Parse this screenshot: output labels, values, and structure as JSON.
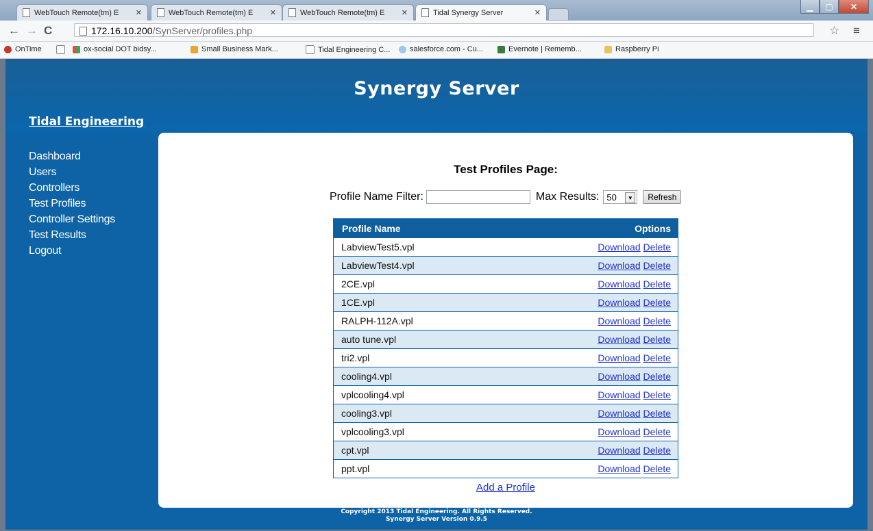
{
  "browser": {
    "tabs": [
      {
        "title": "WebTouch Remote(tm) E",
        "active": false
      },
      {
        "title": "WebTouch Remote(tm) E",
        "active": false
      },
      {
        "title": "WebTouch Remote(tm) E",
        "active": false
      },
      {
        "title": "Tidal Synergy Server",
        "active": true
      }
    ],
    "url_host": "172.16.10.200",
    "url_path": "/SynServer/profiles.php",
    "bookmarks": [
      {
        "label": "OnTime",
        "icon": "ontime-icon",
        "color": "#c0392b"
      },
      {
        "label": "",
        "icon": "page-icon",
        "color": "#ffffff"
      },
      {
        "label": "ox-social DOT bidsy...",
        "icon": "windows-icon",
        "color": "#3a7bd5"
      },
      {
        "label": "Small Business Mark...",
        "icon": "marketing-icon",
        "color": "#e8a534"
      },
      {
        "label": "Tidal Engineering C...",
        "icon": "page-icon",
        "color": "#ffffff"
      },
      {
        "label": "salesforce.com - Cu...",
        "icon": "cloud-icon",
        "color": "#9ec9ea"
      },
      {
        "label": "Evernote | Rememb...",
        "icon": "evernote-icon",
        "color": "#3b7a3b"
      },
      {
        "label": "Raspberry Pi",
        "icon": "folder-icon",
        "color": "#e8c55a"
      }
    ]
  },
  "site": {
    "title": "Synergy Server",
    "brand": "Tidal Engineering",
    "nav": [
      "Dashboard",
      "Users",
      "Controllers",
      "Test Profiles",
      "Controller Settings",
      "Test Results",
      "Logout"
    ],
    "footer_line1": "Copyright 2013 Tidal Engineering. All Rights Reserved.",
    "footer_line2": "Synergy Server Version 0.9.5"
  },
  "page": {
    "heading": "Test Profiles Page:",
    "filter_label": "Profile Name Filter:",
    "filter_value": "",
    "max_label": "Max Results:",
    "max_value": "50",
    "refresh_label": "Refresh",
    "table_headers": {
      "name": "Profile Name",
      "options": "Options"
    },
    "download_label": "Download",
    "delete_label": "Delete",
    "profiles": [
      "LabviewTest5.vpl",
      "LabviewTest4.vpl",
      "2CE.vpl",
      "1CE.vpl",
      "RALPH-112A.vpl",
      "auto tune.vpl",
      "tri2.vpl",
      "cooling4.vpl",
      "vplcooling4.vpl",
      "cooling3.vpl",
      "vplcooling3.vpl",
      "cpt.vpl",
      "ppt.vpl"
    ],
    "add_link": "Add a Profile"
  }
}
